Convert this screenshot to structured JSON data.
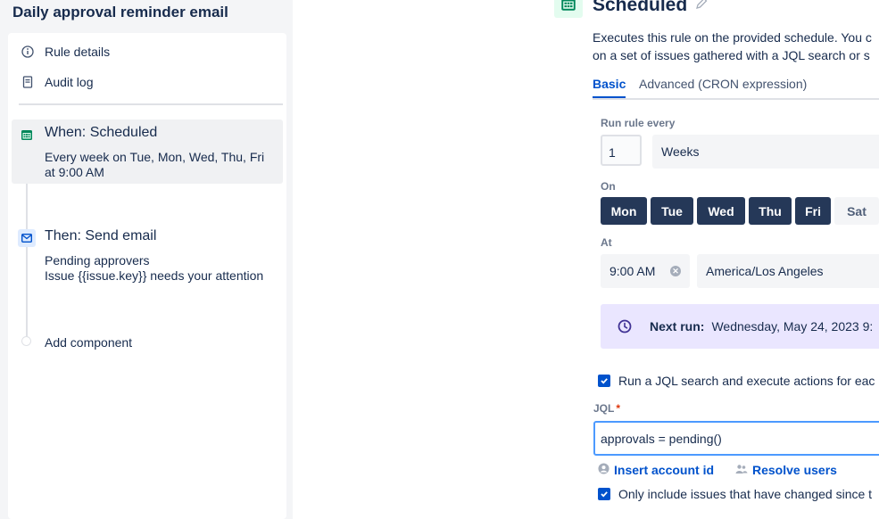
{
  "rule": {
    "title": "Daily approval reminder email",
    "nav": [
      {
        "label": "Rule details",
        "icon": "info-icon"
      },
      {
        "label": "Audit log",
        "icon": "document-icon"
      }
    ],
    "components": [
      {
        "title": "When: Scheduled",
        "desc_lines": [
          "Every week on Tue, Mon, Wed, Thu, Fri",
          "at 9:00 AM"
        ],
        "icon": "calendar-icon",
        "color": "#00875a"
      },
      {
        "title": "Then: Send email",
        "desc_lines": [
          "Pending approvers",
          "Issue {{issue.key}} needs your attention"
        ],
        "icon": "mail-icon",
        "color": "#0052cc"
      }
    ],
    "add_component": "Add component"
  },
  "schedule": {
    "title": "Scheduled",
    "desc_line1": "Executes this rule on the provided schedule. You c",
    "desc_line2": "on a set of issues gathered with a JQL search or s",
    "tabs": [
      "Basic",
      "Advanced (CRON expression)"
    ],
    "active_tab": "Basic",
    "run_every_label": "Run rule every",
    "run_every_value": "1",
    "run_every_unit": "Weeks",
    "on_label": "On",
    "days": [
      {
        "label": "Mon",
        "selected": true
      },
      {
        "label": "Tue",
        "selected": true
      },
      {
        "label": "Wed",
        "selected": true
      },
      {
        "label": "Thu",
        "selected": true
      },
      {
        "label": "Fri",
        "selected": true
      },
      {
        "label": "Sat",
        "selected": false
      }
    ],
    "at_label": "At",
    "time": "9:00 AM",
    "timezone": "America/Los Angeles",
    "next_run_label": "Next run:",
    "next_run_value": "Wednesday, May 24, 2023 9:",
    "jql_checkbox_label": "Run a JQL search and execute actions for eac",
    "jql_checkbox_checked": true,
    "jql_label": "JQL",
    "jql_required_mark": "*",
    "jql_value": "approvals = pending()",
    "insert_account_id": "Insert account id",
    "resolve_users": "Resolve users",
    "only_changed_label": "Only include issues that have changed since t",
    "only_changed_checked": true
  },
  "colors": {
    "accent": "#0052cc",
    "day_selected_bg": "#253858",
    "next_run_bg": "#eae6ff",
    "scheduled_icon_bg": "#e3fcef"
  }
}
